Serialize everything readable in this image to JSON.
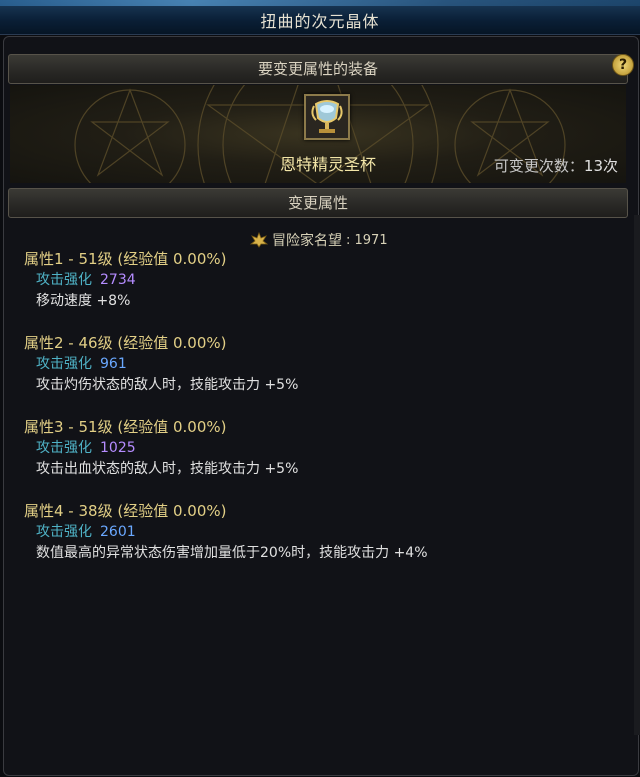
{
  "window": {
    "title": "扭曲的次元晶体"
  },
  "equip_section": {
    "header": "要变更属性的装备",
    "help_label": "?"
  },
  "item": {
    "name": "恩特精灵圣杯",
    "change_count_label": "可变更次数",
    "change_count_value": "13次",
    "icon": "grail-icon"
  },
  "change_section": {
    "header": "变更属性"
  },
  "fame": {
    "label": "冒险家名望",
    "value": "1971",
    "icon": "fame-emblem-icon"
  },
  "attributes": [
    {
      "title": "属性1 - 51级 (经验值 0.00%)",
      "label": "攻击强化",
      "value": "2734",
      "value_color": "#b58cff",
      "effect": "移动速度 +8%"
    },
    {
      "title": "属性2 - 46级 (经验值 0.00%)",
      "label": "攻击强化",
      "value": "961",
      "value_color": "#6aa8ff",
      "effect": "攻击灼伤状态的敌人时，技能攻击力 +5%"
    },
    {
      "title": "属性3 - 51级 (经验值 0.00%)",
      "label": "攻击强化",
      "value": "1025",
      "value_color": "#b58cff",
      "effect": "攻击出血状态的敌人时，技能攻击力 +5%"
    },
    {
      "title": "属性4 - 38级 (经验值 0.00%)",
      "label": "攻击强化",
      "value": "2601",
      "value_color": "#6aa8ff",
      "effect": "数值最高的异常状态伤害增加量低于20%时，技能攻击力 +4%"
    }
  ]
}
